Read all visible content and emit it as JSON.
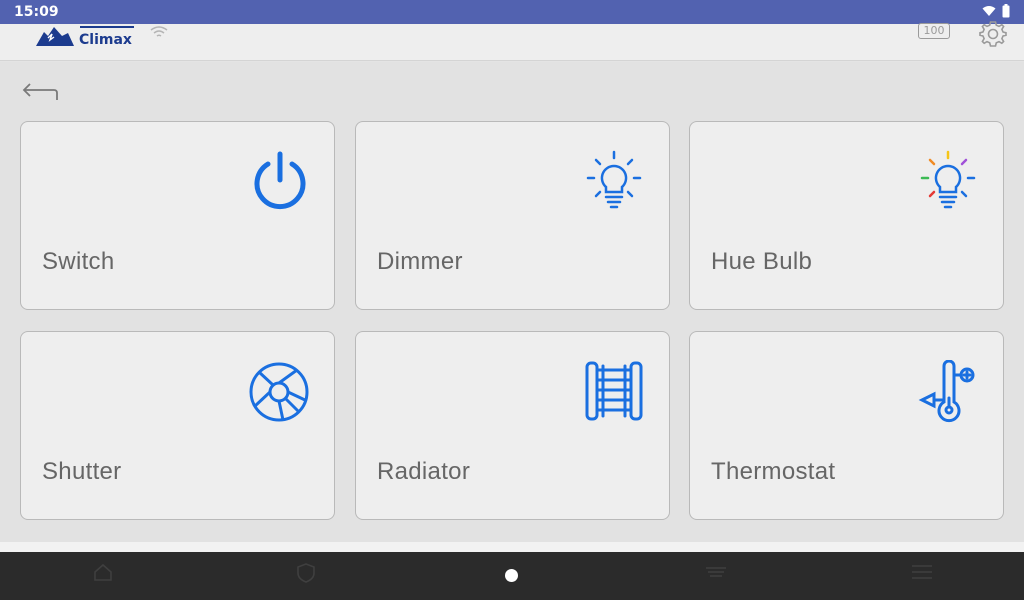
{
  "status_bar": {
    "time": "15:09",
    "wifi_icon": "wifi-icon",
    "battery_icon": "battery-icon"
  },
  "header": {
    "brand": "Climax",
    "battery_label": "100",
    "settings_icon": "gear-icon",
    "signal_icon": "wifi-signal-icon"
  },
  "navigation": {
    "back_icon": "back-arrow-icon"
  },
  "devices": [
    {
      "label": "Switch",
      "icon": "power-icon"
    },
    {
      "label": "Dimmer",
      "icon": "bulb-icon"
    },
    {
      "label": "Hue Bulb",
      "icon": "color-bulb-icon"
    },
    {
      "label": "Shutter",
      "icon": "shutter-icon"
    },
    {
      "label": "Radiator",
      "icon": "radiator-icon"
    },
    {
      "label": "Thermostat",
      "icon": "thermostat-icon"
    }
  ],
  "colors": {
    "accent": "#1a6fe0",
    "status_bar": "#5262b0",
    "nav_bar": "#2b2b2b"
  }
}
